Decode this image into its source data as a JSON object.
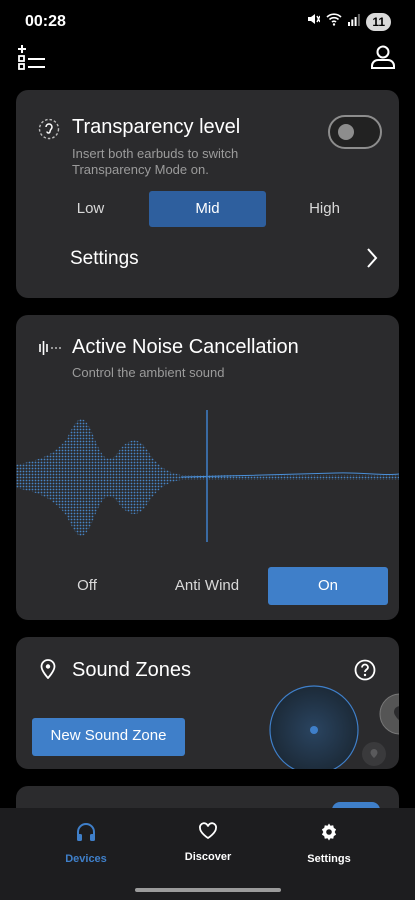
{
  "status": {
    "time": "00:28",
    "battery": "11"
  },
  "transparency": {
    "title": "Transparency level",
    "subtitle_line1": "Insert both earbuds to switch",
    "subtitle_line2": "Transparency Mode on.",
    "options": [
      "Low",
      "Mid",
      "High"
    ],
    "selected": "Mid",
    "settings_label": "Settings",
    "toggle_on": false
  },
  "anc": {
    "title": "Active Noise Cancellation",
    "subtitle": "Control the ambient sound",
    "options": [
      "Off",
      "Anti Wind",
      "On"
    ],
    "selected": "On"
  },
  "sound_zones": {
    "title": "Sound Zones",
    "button_label": "New Sound Zone"
  },
  "nav": {
    "items": [
      "Devices",
      "Discover",
      "Settings"
    ],
    "active": "Devices"
  },
  "colors": {
    "accent": "#3f7fc9",
    "card": "#2b2b2d",
    "nav_bg": "#1d1d1f"
  }
}
